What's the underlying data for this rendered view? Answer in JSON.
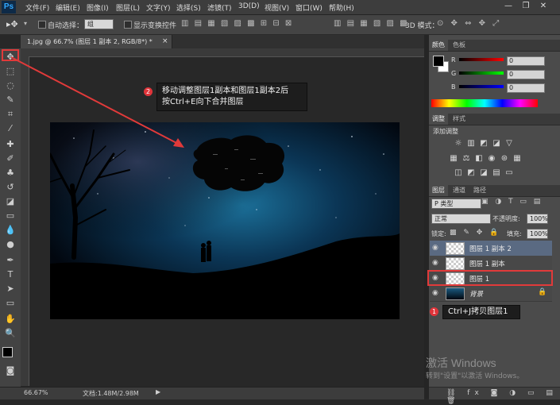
{
  "app": {
    "logo": "Ps"
  },
  "menu": [
    "文件(F)",
    "编辑(E)",
    "图像(I)",
    "图层(L)",
    "文字(Y)",
    "选择(S)",
    "滤镜(T)",
    "3D(D)",
    "视图(V)",
    "窗口(W)",
    "帮助(H)"
  ],
  "window_controls": [
    "—",
    "❐",
    "✕"
  ],
  "options": {
    "auto_select_label": "自动选择：",
    "auto_select_value": "组",
    "show_transform_label": "显示变换控件",
    "mode_3d_label": "3D 模式："
  },
  "document": {
    "tab_title": "1.jpg @ 66.7% (图层 1 副本 2, RGB/8*) *",
    "tab_close": "×"
  },
  "status": {
    "zoom": "66.67%",
    "doc_info": "文档:1.48M/2.98M"
  },
  "color_panel": {
    "tabs": [
      "颜色",
      "色板"
    ],
    "channels": [
      {
        "label": "R",
        "value": "0"
      },
      {
        "label": "G",
        "value": "0"
      },
      {
        "label": "B",
        "value": "0"
      }
    ]
  },
  "adjust_panel": {
    "tabs": [
      "调整",
      "样式"
    ],
    "title": "添加调整"
  },
  "layers_panel": {
    "tabs": [
      "图层",
      "通道",
      "路径"
    ],
    "filter_label": "P 类型",
    "blend_mode": "正常",
    "opacity_label": "不透明度:",
    "opacity_value": "100%",
    "lock_label": "锁定:",
    "fill_label": "填充:",
    "fill_value": "100%",
    "layers": [
      "图层 1 副本 2",
      "图层 1 副本",
      "图层 1",
      "背景"
    ]
  },
  "annotations": {
    "step2_number": "2",
    "step2_line1": "移动调整图层1副本和图层1副本2后",
    "step2_line2": "按Ctrl+E向下合并图层",
    "step1_number": "1",
    "step1_text": "Ctrl+J拷贝图层1"
  },
  "watermark": {
    "line1": "激活 Windows",
    "line2": "转到\"设置\"以激活 Windows。"
  },
  "colors": {
    "accent_red": "#e13a3a",
    "selected_layer": "#5a6a82",
    "ps_blue": "#31a8ff"
  }
}
